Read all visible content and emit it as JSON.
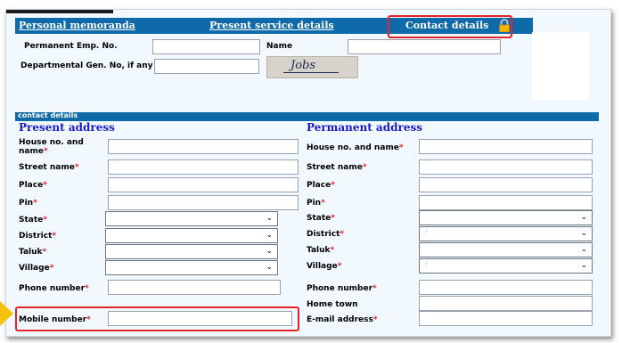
{
  "tabs": {
    "personal": "Personal memoranda",
    "service": "Present service details",
    "contact": "Contact details"
  },
  "top": {
    "emp_no_label": "Permanent Emp. No.",
    "name_label": "Name",
    "gen_no_label": "Departmental Gen. No, if any",
    "signature_text": "Jobs"
  },
  "section": {
    "bar_label": "contact details",
    "present_heading": "Present address",
    "permanent_heading": "Permanent address"
  },
  "present": {
    "house_label_1": "House no. and",
    "house_label_2": "name",
    "street": "Street name",
    "place": "Place",
    "pin": "Pin",
    "state": "State",
    "district": "District",
    "taluk": "Taluk",
    "village": "Village",
    "phone": "Phone number",
    "mobile": "Mobile number"
  },
  "permanent": {
    "house": "House no. and name",
    "street": "Street name",
    "place": "Place",
    "pin": "Pin",
    "state": "State",
    "district": "District",
    "taluk": "Taluk",
    "village": "Village",
    "phone": "Phone number",
    "hometown": "Home town",
    "email": "E-mail address"
  },
  "required_marker": "*",
  "colors": {
    "accent": "#0e6aa8",
    "heading": "#1a1ad0",
    "required": "#e5252a",
    "highlight": "#e5252a",
    "arrow": "#f4c20f"
  },
  "icons": {
    "lock": "padlock-icon",
    "dropdown": "chevron-down-icon"
  }
}
